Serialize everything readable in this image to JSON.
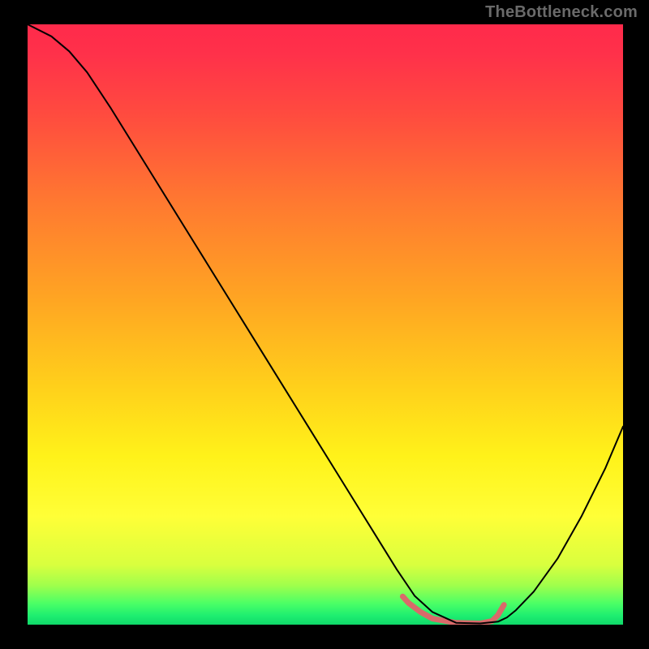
{
  "watermark": "TheBottleneck.com",
  "chart_data": {
    "type": "line",
    "title": "",
    "xlabel": "",
    "ylabel": "",
    "xlim": [
      0,
      100
    ],
    "ylim": [
      0,
      100
    ],
    "grid": false,
    "legend": false,
    "gradient_stops": [
      {
        "offset": 0.0,
        "color": "#ff2a4b"
      },
      {
        "offset": 0.05,
        "color": "#ff314a"
      },
      {
        "offset": 0.15,
        "color": "#ff4b3f"
      },
      {
        "offset": 0.3,
        "color": "#ff7a30"
      },
      {
        "offset": 0.45,
        "color": "#ffa323"
      },
      {
        "offset": 0.6,
        "color": "#ffcf1b"
      },
      {
        "offset": 0.72,
        "color": "#fff21a"
      },
      {
        "offset": 0.82,
        "color": "#ffff37"
      },
      {
        "offset": 0.9,
        "color": "#d9ff3e"
      },
      {
        "offset": 0.935,
        "color": "#9fff4c"
      },
      {
        "offset": 0.965,
        "color": "#4aff66"
      },
      {
        "offset": 0.985,
        "color": "#1eee70"
      },
      {
        "offset": 1.0,
        "color": "#10d96a"
      }
    ],
    "series": [
      {
        "name": "bottleneck-curve",
        "color": "#000000",
        "width": 2,
        "x": [
          0,
          4,
          7,
          10,
          14,
          20,
          28,
          36,
          44,
          52,
          58,
          62,
          65,
          68,
          72,
          76,
          79,
          80.5,
          82,
          85,
          89,
          93,
          97,
          100
        ],
        "y": [
          100,
          98,
          95.5,
          92,
          86,
          76.4,
          63.6,
          50.8,
          38,
          25.2,
          15.6,
          9.2,
          4.8,
          2.1,
          0.3,
          0.2,
          0.5,
          1.2,
          2.4,
          5.5,
          11,
          18,
          26,
          33
        ]
      }
    ],
    "flat_marker": {
      "color": "#d96a6a",
      "width": 7,
      "x": [
        63,
        64,
        66,
        68,
        72,
        76,
        78,
        79,
        80
      ],
      "y": [
        4.7,
        3.6,
        2.1,
        1.0,
        0.3,
        0.2,
        0.6,
        1.6,
        3.3
      ]
    }
  }
}
